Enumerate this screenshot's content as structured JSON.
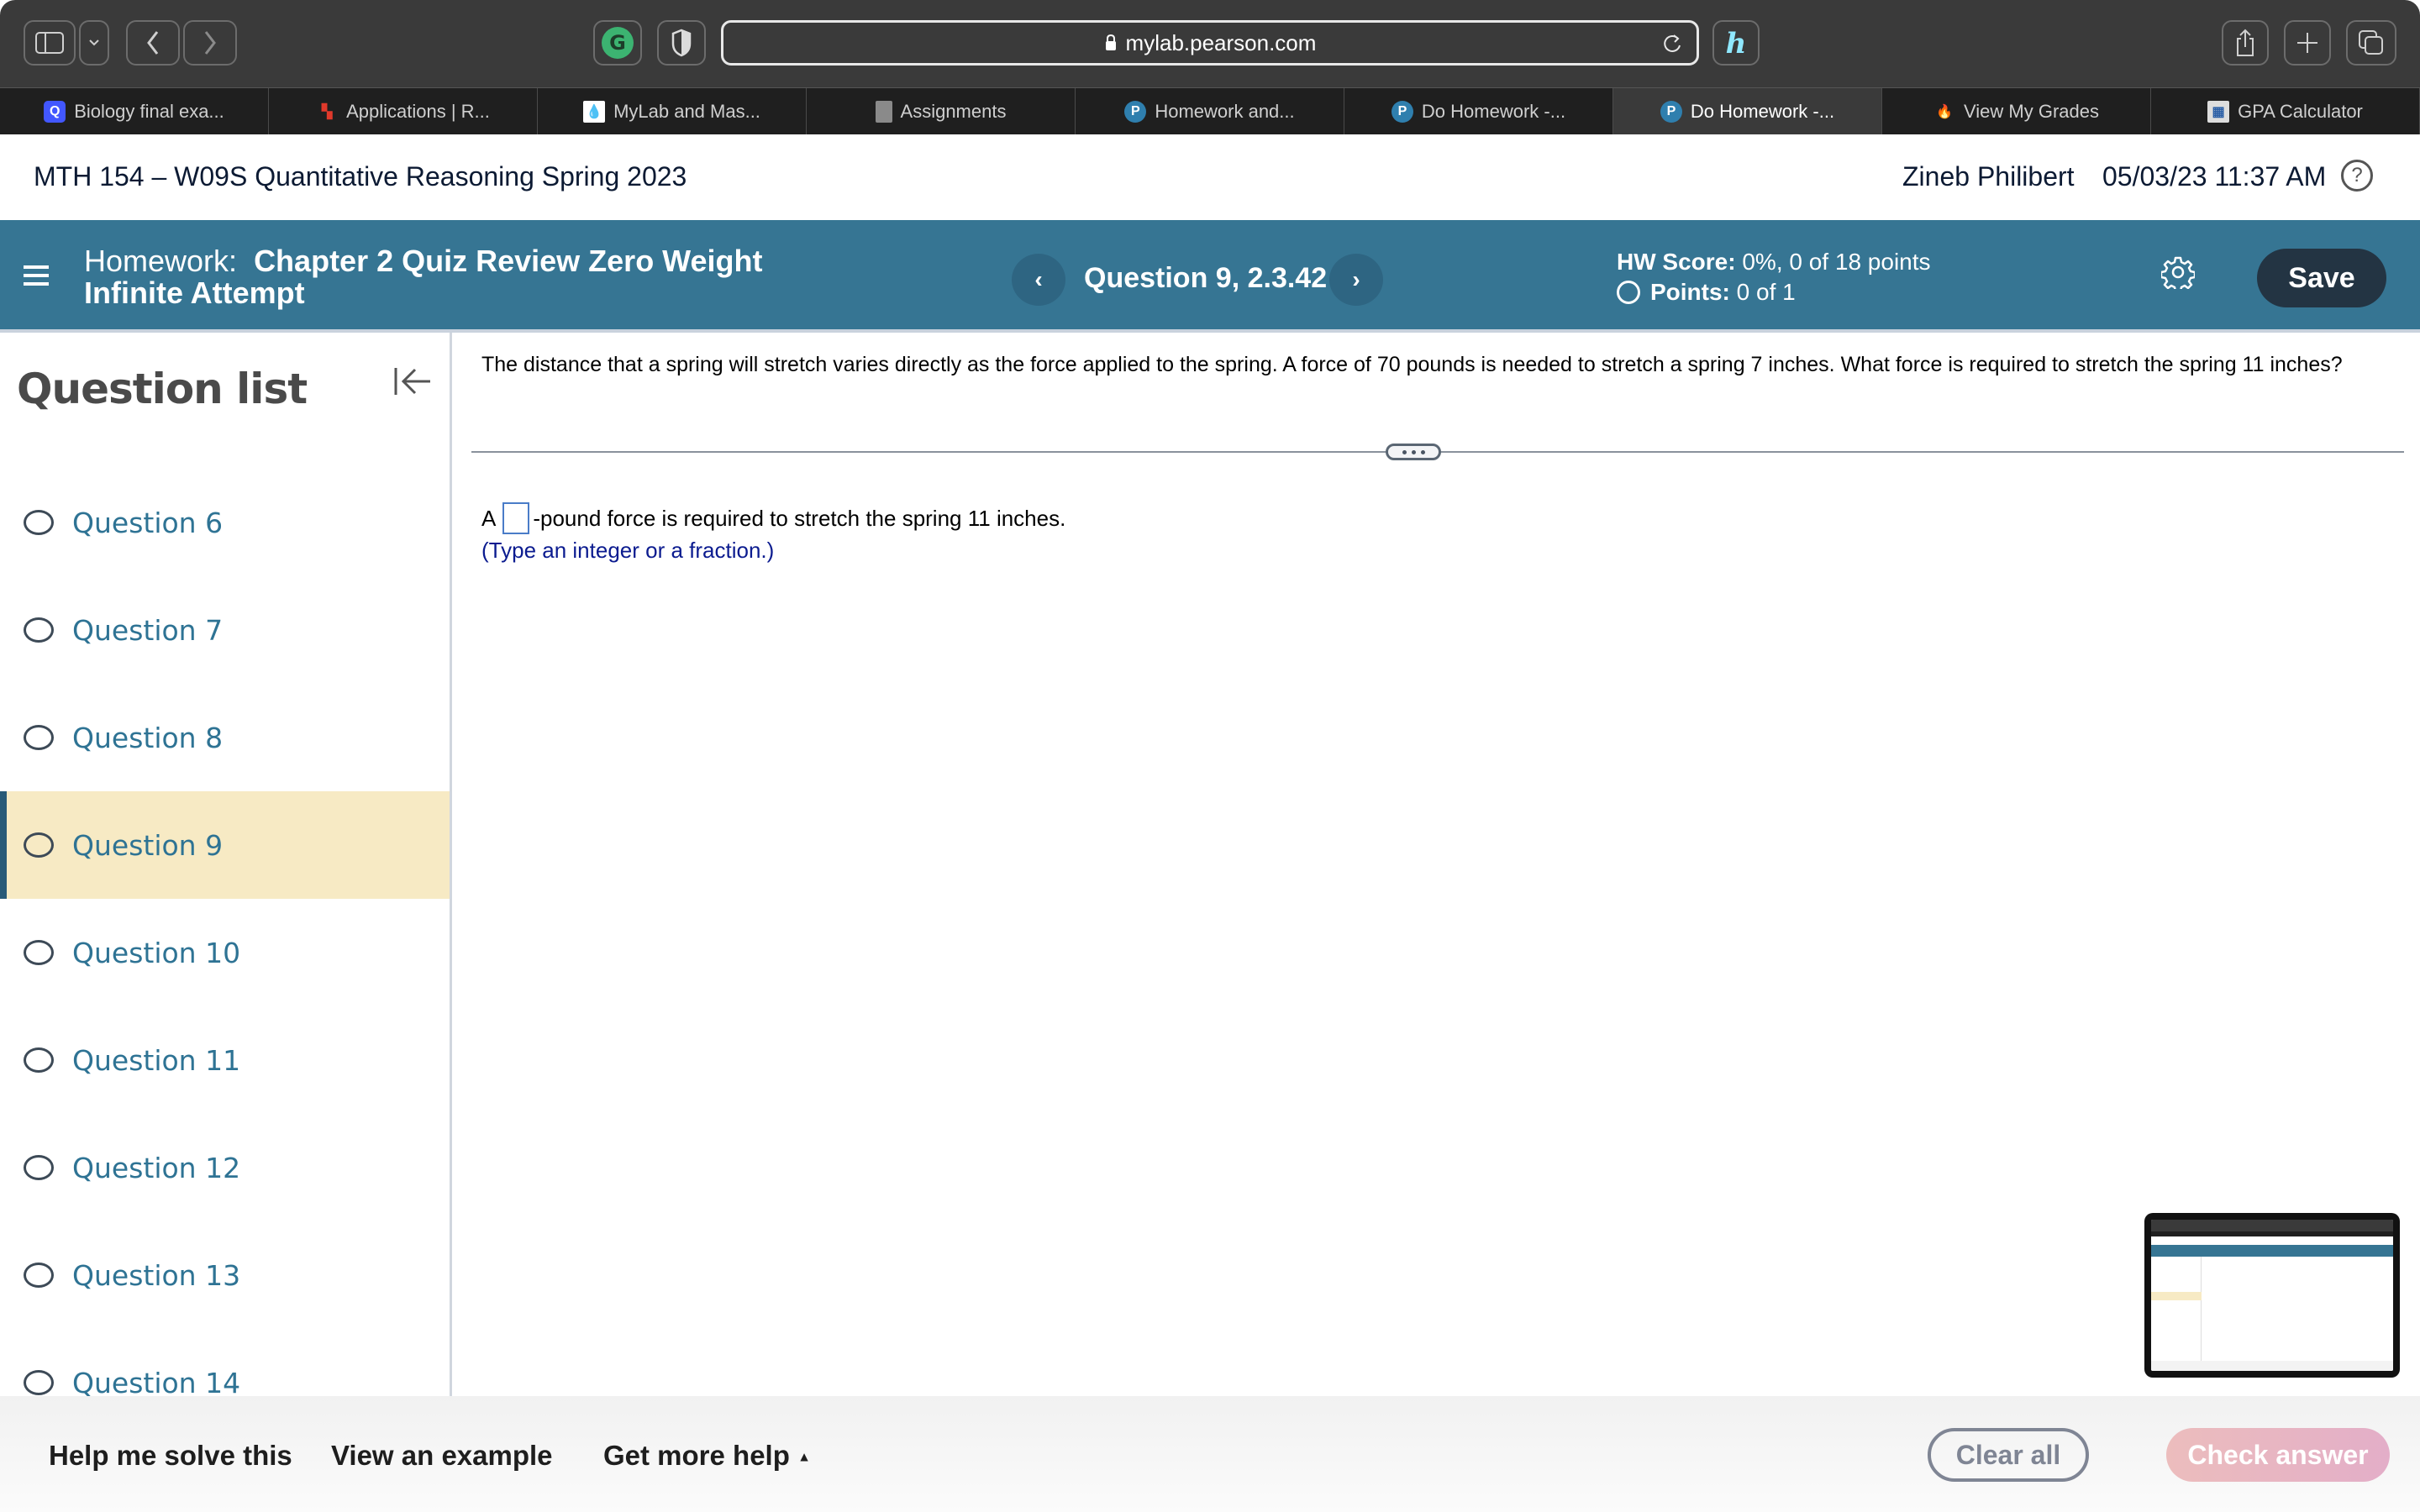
{
  "browser": {
    "url": "mylab.pearson.com",
    "tabs": [
      {
        "label": "Biology final exa...",
        "icon": "quizlet-icon",
        "active": false
      },
      {
        "label": "Applications | R...",
        "icon": "app-logo-icon",
        "active": false
      },
      {
        "label": "MyLab and Mas...",
        "icon": "mylab-icon",
        "active": false
      },
      {
        "label": "Assignments",
        "icon": "document-icon",
        "active": false
      },
      {
        "label": "Homework and...",
        "icon": "pearson-icon",
        "active": false
      },
      {
        "label": "Do Homework -...",
        "icon": "pearson-icon",
        "active": false
      },
      {
        "label": "Do Homework -...",
        "icon": "pearson-icon",
        "active": true
      },
      {
        "label": "View My Grades",
        "icon": "flame-icon",
        "active": false
      },
      {
        "label": "GPA Calculator",
        "icon": "calculator-icon",
        "active": false
      }
    ]
  },
  "course": {
    "title": "MTH 154 – W09S Quantitative Reasoning Spring 2023",
    "user": "Zineb Philibert",
    "datetime": "05/03/23 11:37 AM",
    "help": "?"
  },
  "homework": {
    "label": "Homework:",
    "name": "Chapter 2 Quiz Review Zero Weight Infinite Attempt",
    "question_title": "Question 9, 2.3.42",
    "prev": "‹",
    "next": "›",
    "hw_score_label": "HW Score:",
    "hw_score_value": "0%, 0 of 18 points",
    "points_label": "Points:",
    "points_value": "0 of 1",
    "save_label": "Save"
  },
  "sidebar": {
    "title": "Question list",
    "items": [
      {
        "label": "Question 6",
        "active": false
      },
      {
        "label": "Question 7",
        "active": false
      },
      {
        "label": "Question 8",
        "active": false
      },
      {
        "label": "Question 9",
        "active": true
      },
      {
        "label": "Question 10",
        "active": false
      },
      {
        "label": "Question 11",
        "active": false
      },
      {
        "label": "Question 12",
        "active": false
      },
      {
        "label": "Question 13",
        "active": false
      },
      {
        "label": "Question 14",
        "active": false
      }
    ]
  },
  "question": {
    "text": "The distance that a spring will stretch varies directly as the force applied to the spring. A force of 70 pounds is needed to stretch a spring 7 inches. What force is required to stretch the spring 11 inches?",
    "answer_prefix": "A",
    "answer_value": "",
    "answer_suffix": "-pound force is required to stretch the spring 11 inches.",
    "hint": "(Type an integer or a fraction.)"
  },
  "footer": {
    "help_me_solve": "Help me solve this",
    "view_example": "View an example",
    "get_more_help": "Get more help",
    "get_more_help_caret": "▲",
    "clear_all": "Clear all",
    "check_answer": "Check answer"
  },
  "colors": {
    "hw_bar": "#367593",
    "save_button": "#233443",
    "active_question_bg": "#f7eac4",
    "question_link": "#2e7394",
    "hint_text": "#0b1b8f",
    "check_answer_gradient_start": "#ecbdbd",
    "check_answer_gradient_end": "#e3aec8"
  }
}
